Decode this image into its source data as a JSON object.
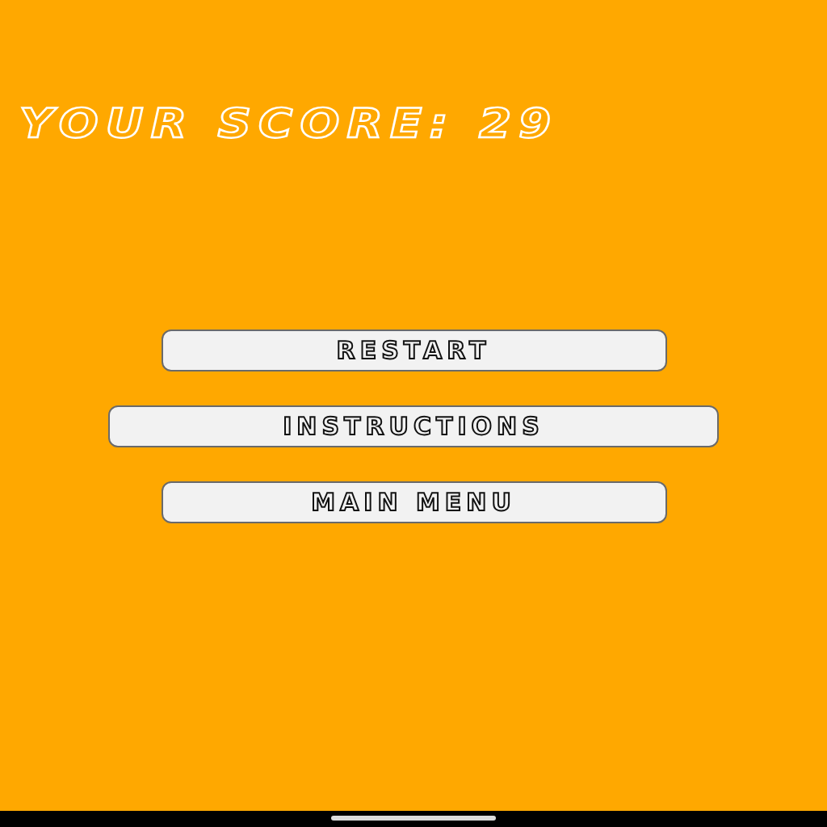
{
  "score_title": "YOUR SCORE: 29",
  "buttons": [
    {
      "label": "RESTART",
      "kind": "narrow"
    },
    {
      "label": "INSTRUCTIONS",
      "kind": "wide"
    },
    {
      "label": "MAIN MENU",
      "kind": "narrow"
    }
  ]
}
